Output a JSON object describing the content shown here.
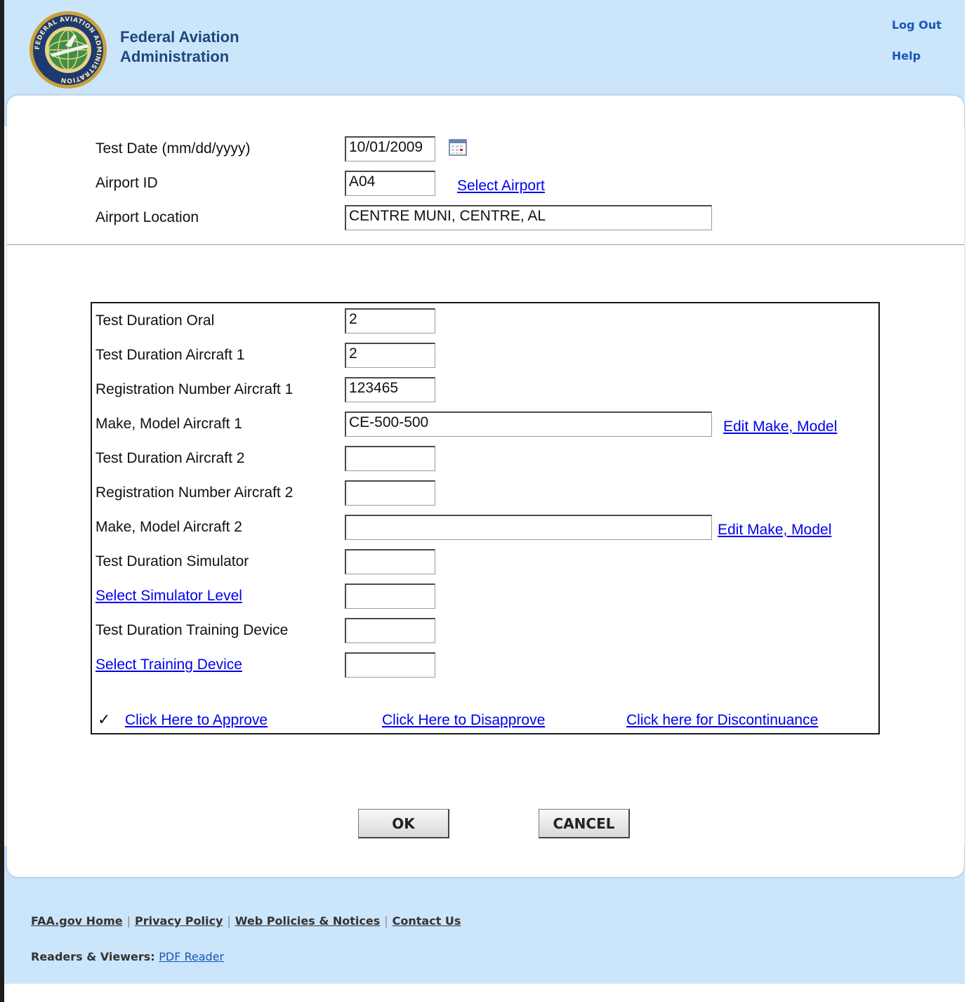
{
  "header": {
    "agency_line1": "Federal Aviation",
    "agency_line2": "Administration",
    "logout_label": "Log Out",
    "help_label": "Help",
    "logo_text": "FEDERAL AVIATION ADMINISTRATION"
  },
  "form_top": {
    "test_date_label": "Test Date (mm/dd/yyyy)",
    "test_date_value": "10/01/2009",
    "airport_id_label": "Airport ID",
    "airport_id_value": "A04",
    "select_airport_label": "Select Airport",
    "airport_location_label": "Airport Location",
    "airport_location_value": "CENTRE MUNI, CENTRE, AL"
  },
  "details": {
    "oral_label": "Test Duration Oral",
    "oral_value": "2",
    "aircraft1_duration_label": "Test Duration Aircraft 1",
    "aircraft1_duration_value": "2",
    "aircraft1_reg_label": "Registration Number Aircraft 1",
    "aircraft1_reg_value": "123465",
    "aircraft1_make_label": "Make, Model Aircraft 1",
    "aircraft1_make_value": "CE-500-500",
    "edit_make_model_label": "Edit Make, Model",
    "aircraft2_duration_label": "Test Duration Aircraft 2",
    "aircraft2_duration_value": "",
    "aircraft2_reg_label": "Registration Number Aircraft 2",
    "aircraft2_reg_value": "",
    "aircraft2_make_label": "Make, Model Aircraft 2",
    "aircraft2_make_value": "",
    "simulator_duration_label": "Test Duration Simulator",
    "simulator_duration_value": "",
    "select_simulator_label": "Select Simulator Level",
    "simulator_level_value": "",
    "training_duration_label": "Test Duration Training Device",
    "training_duration_value": "",
    "select_training_label": "Select Training Device",
    "training_device_value": "",
    "approve_check": "✓",
    "approve_label": "Click Here to Approve",
    "disapprove_label": "Click Here to Disapprove",
    "discontinuance_label": "Click here for Discontinuance"
  },
  "buttons": {
    "ok_label": "OK",
    "cancel_label": "CANCEL"
  },
  "footer": {
    "links": [
      "FAA.gov Home",
      "Privacy Policy",
      "Web Policies & Notices",
      "Contact Us"
    ],
    "readers_label": "Readers & Viewers:",
    "pdf_reader_label": "PDF Reader"
  },
  "colors": {
    "band_blue": "#cbe5fb",
    "link_blue": "#0000ee",
    "agency_navy": "#1f4878"
  }
}
